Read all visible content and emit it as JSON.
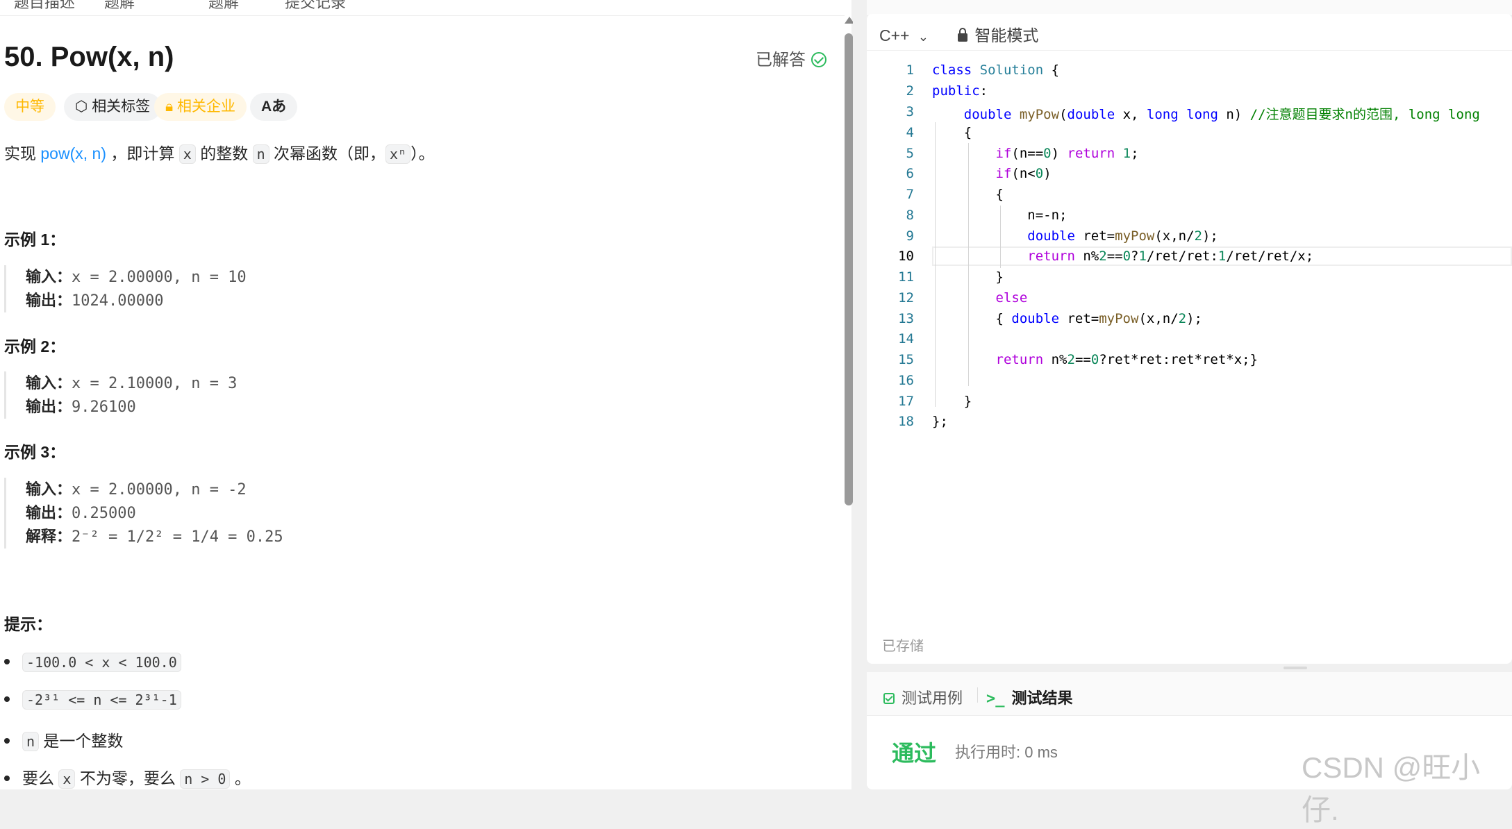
{
  "left_topbar": {
    "tab_description": "题目描述",
    "tab_solutions": "题解",
    "tab_answers": "题解",
    "tab_submissions": "提交记录"
  },
  "problem": {
    "title": "50. Pow(x, n)",
    "status": "已解答",
    "difficulty": "中等",
    "tag_topics": "相关标签",
    "tag_companies": "相关企业",
    "tag_font": "Aあ",
    "desc_pre": "实现 ",
    "desc_link": "pow(x, n)",
    "desc_mid1": " ，即计算 ",
    "desc_code_x": "x",
    "desc_mid2": " 的整数 ",
    "desc_code_n": "n",
    "desc_mid3": " 次幂函数（即，",
    "desc_code_xn": "xⁿ",
    "desc_end": "）。",
    "examples": [
      {
        "heading": "示例 1：",
        "input_label": "输入：",
        "input": "x = 2.00000, n = 10",
        "output_label": "输出：",
        "output": "1024.00000"
      },
      {
        "heading": "示例 2：",
        "input_label": "输入：",
        "input": "x = 2.10000, n = 3",
        "output_label": "输出：",
        "output": "9.26100"
      },
      {
        "heading": "示例 3：",
        "input_label": "输入：",
        "input": "x = 2.00000, n = -2",
        "output_label": "输出：",
        "output": "0.25000",
        "explain_label": "解释：",
        "explain": "2⁻² = 1/2² = 1/4 = 0.25"
      }
    ],
    "hints_heading": "提示：",
    "hint1": "-100.0 < x < 100.0",
    "hint2": "-2³¹ <= n <= 2³¹-1",
    "hint3_code": "n",
    "hint3_text": " 是一个整数",
    "hint4_pre": "要么 ",
    "hint4_code1": "x",
    "hint4_mid": " 不为零，要么 ",
    "hint4_code2": "n > 0",
    "hint4_end": " 。"
  },
  "editor": {
    "language": "C++",
    "mode": "智能模式",
    "saved": "已存储",
    "current_line": 10
  },
  "results": {
    "tab_testcase": "测试用例",
    "tab_result": "测试结果",
    "status": "通过",
    "runtime": "执行用时: 0 ms"
  },
  "watermark": "CSDN @旺小仔."
}
